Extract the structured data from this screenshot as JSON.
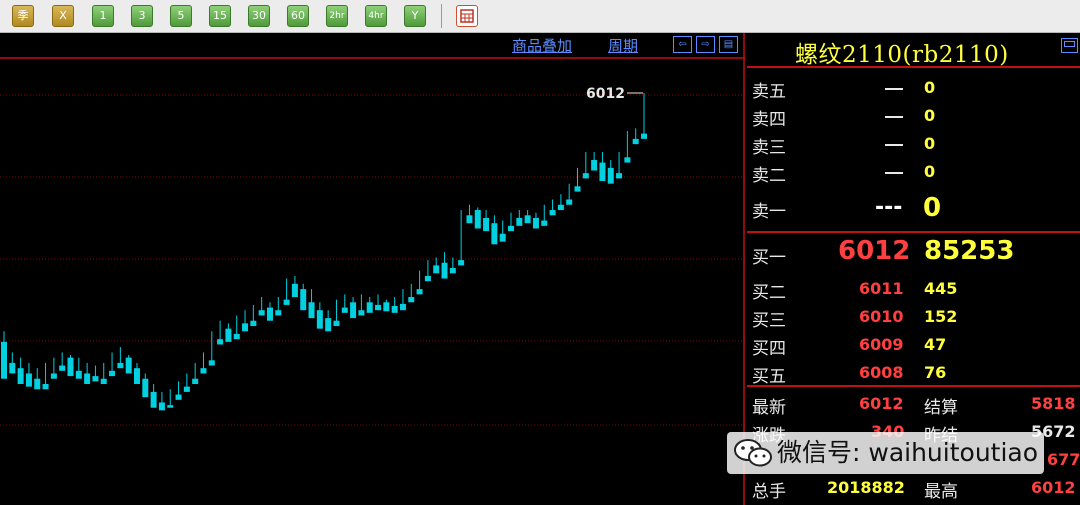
{
  "toolbar": {
    "buttons": [
      "季",
      "X",
      "1",
      "3",
      "5",
      "15",
      "30",
      "60",
      "2hr",
      "4hr",
      "Y"
    ],
    "extra_icon": "grid-icon"
  },
  "chart_header": {
    "overlay_label": "商品叠加",
    "period_label": "周期"
  },
  "chart": {
    "marker_label": "6012",
    "min": 5405,
    "max": 6012,
    "up_color": "#ff3030",
    "down_color": "#00d0e0",
    "candles": [
      [
        5540,
        5560,
        5480,
        5470
      ],
      [
        5500,
        5520,
        5490,
        5480
      ],
      [
        5490,
        5510,
        5470,
        5460
      ],
      [
        5480,
        5500,
        5470,
        5455
      ],
      [
        5470,
        5490,
        5460,
        5450
      ],
      [
        5460,
        5500,
        5455,
        5450
      ],
      [
        5480,
        5510,
        5475,
        5470
      ],
      [
        5495,
        5520,
        5490,
        5485
      ],
      [
        5510,
        5515,
        5485,
        5475
      ],
      [
        5485,
        5510,
        5480,
        5470
      ],
      [
        5480,
        5500,
        5470,
        5460
      ],
      [
        5475,
        5495,
        5470,
        5465
      ],
      [
        5470,
        5500,
        5465,
        5460
      ],
      [
        5485,
        5520,
        5480,
        5475
      ],
      [
        5500,
        5530,
        5495,
        5490
      ],
      [
        5510,
        5515,
        5490,
        5480
      ],
      [
        5490,
        5500,
        5470,
        5460
      ],
      [
        5470,
        5480,
        5445,
        5435
      ],
      [
        5445,
        5460,
        5425,
        5415
      ],
      [
        5425,
        5445,
        5420,
        5410
      ],
      [
        5420,
        5450,
        5418,
        5415
      ],
      [
        5440,
        5465,
        5435,
        5430
      ],
      [
        5455,
        5480,
        5450,
        5445
      ],
      [
        5470,
        5500,
        5465,
        5460
      ],
      [
        5490,
        5520,
        5485,
        5480
      ],
      [
        5505,
        5560,
        5500,
        5495
      ],
      [
        5545,
        5580,
        5540,
        5535
      ],
      [
        5565,
        5575,
        5550,
        5540
      ],
      [
        5555,
        5590,
        5550,
        5545
      ],
      [
        5575,
        5600,
        5565,
        5560
      ],
      [
        5580,
        5610,
        5575,
        5570
      ],
      [
        5600,
        5625,
        5595,
        5590
      ],
      [
        5605,
        5615,
        5590,
        5580
      ],
      [
        5600,
        5625,
        5598,
        5590
      ],
      [
        5620,
        5660,
        5615,
        5610
      ],
      [
        5650,
        5665,
        5630,
        5625
      ],
      [
        5640,
        5650,
        5610,
        5600
      ],
      [
        5615,
        5640,
        5590,
        5585
      ],
      [
        5600,
        5615,
        5580,
        5565
      ],
      [
        5585,
        5600,
        5570,
        5560
      ],
      [
        5580,
        5620,
        5575,
        5570
      ],
      [
        5605,
        5630,
        5600,
        5595
      ],
      [
        5615,
        5625,
        5595,
        5585
      ],
      [
        5600,
        5630,
        5598,
        5590
      ],
      [
        5615,
        5625,
        5600,
        5595
      ],
      [
        5610,
        5630,
        5605,
        5600
      ],
      [
        5615,
        5620,
        5605,
        5598
      ],
      [
        5608,
        5625,
        5600,
        5595
      ],
      [
        5612,
        5640,
        5605,
        5600
      ],
      [
        5625,
        5650,
        5620,
        5615
      ],
      [
        5640,
        5675,
        5635,
        5630
      ],
      [
        5665,
        5695,
        5660,
        5655
      ],
      [
        5685,
        5700,
        5675,
        5670
      ],
      [
        5690,
        5710,
        5670,
        5660
      ],
      [
        5680,
        5700,
        5675,
        5670
      ],
      [
        5695,
        5790,
        5690,
        5685
      ],
      [
        5780,
        5800,
        5770,
        5765
      ],
      [
        5790,
        5795,
        5765,
        5755
      ],
      [
        5775,
        5790,
        5760,
        5750
      ],
      [
        5765,
        5780,
        5740,
        5725
      ],
      [
        5745,
        5770,
        5735,
        5730
      ],
      [
        5760,
        5785,
        5755,
        5750
      ],
      [
        5775,
        5790,
        5765,
        5760
      ],
      [
        5780,
        5790,
        5770,
        5765
      ],
      [
        5775,
        5785,
        5760,
        5755
      ],
      [
        5770,
        5800,
        5765,
        5760
      ],
      [
        5790,
        5810,
        5785,
        5780
      ],
      [
        5800,
        5820,
        5795,
        5790
      ],
      [
        5810,
        5840,
        5805,
        5800
      ],
      [
        5835,
        5870,
        5830,
        5825
      ],
      [
        5860,
        5900,
        5855,
        5850
      ],
      [
        5885,
        5900,
        5870,
        5865
      ],
      [
        5880,
        5900,
        5860,
        5845
      ],
      [
        5870,
        5885,
        5850,
        5840
      ],
      [
        5860,
        5900,
        5855,
        5850
      ],
      [
        5890,
        5940,
        5885,
        5880
      ],
      [
        5925,
        5945,
        5920,
        5915
      ],
      [
        5935,
        6012,
        5930,
        5925
      ]
    ]
  },
  "panel": {
    "title": "螺纹2110(rb2110)",
    "sell_levels": [
      {
        "label": "卖五",
        "volume": "0"
      },
      {
        "label": "卖四",
        "volume": "0"
      },
      {
        "label": "卖三",
        "volume": "0"
      },
      {
        "label": "卖二",
        "volume": "0"
      }
    ],
    "sell1": {
      "label": "卖一",
      "price": "---",
      "volume": "0"
    },
    "buy1": {
      "label": "买一",
      "price": "6012",
      "volume": "85253"
    },
    "buy_levels": [
      {
        "label": "买二",
        "price": "6011",
        "volume": "445"
      },
      {
        "label": "买三",
        "price": "6010",
        "volume": "152"
      },
      {
        "label": "买四",
        "price": "6009",
        "volume": "47"
      },
      {
        "label": "买五",
        "price": "6008",
        "volume": "76"
      }
    ],
    "stats": {
      "latest_label": "最新",
      "latest": "6012",
      "settle_label": "结算",
      "settle": "5818",
      "change_label": "涨跌",
      "change": "340",
      "prev_settle_label": "昨结",
      "prev_settle": "5672",
      "row3_right": "677",
      "volume_label": "总手",
      "volume": "2018882",
      "high_label": "最高",
      "high": "6012"
    }
  },
  "watermark": {
    "text": "微信号: waihuitoutiao"
  }
}
